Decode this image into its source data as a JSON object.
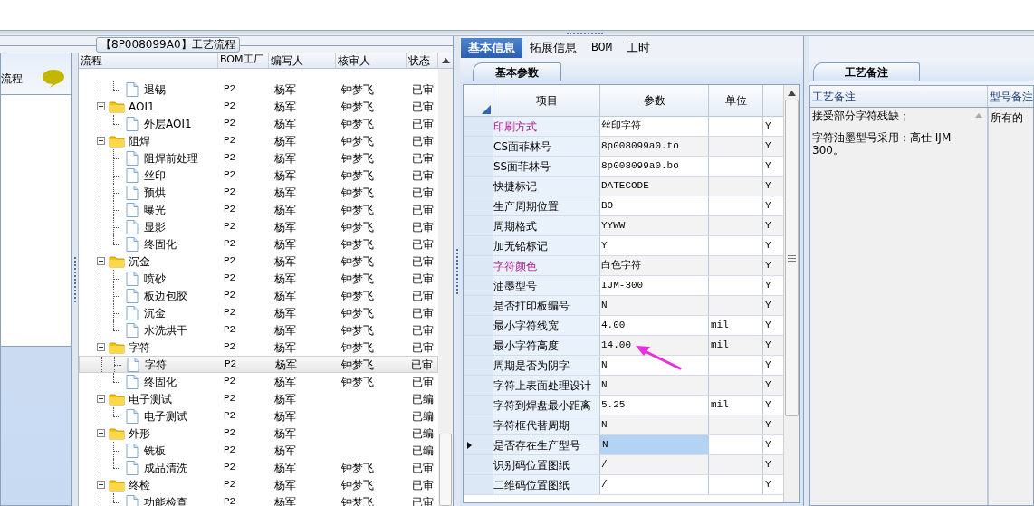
{
  "left_panel": {
    "title": "流程"
  },
  "process_panel": {
    "title": "【8P008099A0】工艺流程",
    "columns": [
      "流程",
      "BOM工厂",
      "编写人",
      "核审人",
      "状态"
    ],
    "continued_children": [
      {
        "name": "退锡",
        "factory": "P2",
        "author": "杨军",
        "reviewer": "钟梦飞",
        "status": "已审",
        "selected": false
      }
    ],
    "groups": [
      {
        "name": "AOI1",
        "factory": "P2",
        "author": "杨军",
        "reviewer": "钟梦飞",
        "status": "已审",
        "expanded": true,
        "selected": false,
        "children": [
          {
            "name": "外层AOI1",
            "factory": "P2",
            "author": "杨军",
            "reviewer": "钟梦飞",
            "status": "已审",
            "selected": false
          }
        ]
      },
      {
        "name": "阻焊",
        "factory": "P2",
        "author": "杨军",
        "reviewer": "钟梦飞",
        "status": "已审",
        "expanded": true,
        "selected": false,
        "children": [
          {
            "name": "阻焊前处理",
            "factory": "P2",
            "author": "杨军",
            "reviewer": "钟梦飞",
            "status": "已审",
            "selected": false
          },
          {
            "name": "丝印",
            "factory": "P2",
            "author": "杨军",
            "reviewer": "钟梦飞",
            "status": "已审",
            "selected": false
          },
          {
            "name": "预烘",
            "factory": "P2",
            "author": "杨军",
            "reviewer": "钟梦飞",
            "status": "已审",
            "selected": false
          },
          {
            "name": "曝光",
            "factory": "P2",
            "author": "杨军",
            "reviewer": "钟梦飞",
            "status": "已审",
            "selected": false
          },
          {
            "name": "显影",
            "factory": "P2",
            "author": "杨军",
            "reviewer": "钟梦飞",
            "status": "已审",
            "selected": false
          },
          {
            "name": "终固化",
            "factory": "P2",
            "author": "杨军",
            "reviewer": "钟梦飞",
            "status": "已审",
            "selected": false
          }
        ]
      },
      {
        "name": "沉金",
        "factory": "P2",
        "author": "杨军",
        "reviewer": "钟梦飞",
        "status": "已审",
        "expanded": true,
        "selected": false,
        "children": [
          {
            "name": "喷砂",
            "factory": "P2",
            "author": "杨军",
            "reviewer": "钟梦飞",
            "status": "已审",
            "selected": false
          },
          {
            "name": "板边包胶",
            "factory": "P2",
            "author": "杨军",
            "reviewer": "钟梦飞",
            "status": "已审",
            "selected": false
          },
          {
            "name": "沉金",
            "factory": "P2",
            "author": "杨军",
            "reviewer": "钟梦飞",
            "status": "已审",
            "selected": false
          },
          {
            "name": "水洗烘干",
            "factory": "P2",
            "author": "杨军",
            "reviewer": "钟梦飞",
            "status": "已审",
            "selected": false
          }
        ]
      },
      {
        "name": "字符",
        "factory": "P2",
        "author": "杨军",
        "reviewer": "钟梦飞",
        "status": "已审",
        "expanded": true,
        "selected": false,
        "children": [
          {
            "name": "字符",
            "factory": "P2",
            "author": "杨军",
            "reviewer": "钟梦飞",
            "status": "已审",
            "selected": true
          },
          {
            "name": "终固化",
            "factory": "P2",
            "author": "杨军",
            "reviewer": "钟梦飞",
            "status": "已审",
            "selected": false
          }
        ]
      },
      {
        "name": "电子测试",
        "factory": "P2",
        "author": "杨军",
        "status": "已编",
        "expanded": true,
        "selected": false,
        "children": [
          {
            "name": "电子测试",
            "factory": "P2",
            "author": "杨军",
            "status": "已编",
            "selected": false
          }
        ]
      },
      {
        "name": "外形",
        "factory": "P2",
        "author": "杨军",
        "status": "已编",
        "expanded": true,
        "selected": false,
        "children": [
          {
            "name": "铣板",
            "factory": "P2",
            "author": "杨军",
            "status": "已编",
            "selected": false
          },
          {
            "name": "成品清洗",
            "factory": "P2",
            "author": "杨军",
            "reviewer": "钟梦飞",
            "status": "已审",
            "selected": false
          }
        ]
      },
      {
        "name": "终检",
        "factory": "P2",
        "author": "杨军",
        "reviewer": "钟梦飞",
        "status": "已审",
        "expanded": true,
        "selected": false,
        "children": [
          {
            "name": "功能检查",
            "factory": "P2",
            "author": "杨军",
            "reviewer": "钟梦飞",
            "status": "已审",
            "selected": false
          }
        ]
      }
    ]
  },
  "detail_panel": {
    "tabs": [
      {
        "label": "基本信息",
        "selected": true
      },
      {
        "label": "拓展信息",
        "selected": false
      },
      {
        "label": "BOM",
        "selected": false
      },
      {
        "label": "工时",
        "selected": false
      }
    ],
    "subtab": "基本参数",
    "columns": [
      "项目",
      "参数",
      "单位"
    ],
    "rows": [
      {
        "item": "印刷方式",
        "value": "丝印字符",
        "flag": "Y",
        "highlight": true,
        "current": false
      },
      {
        "item": "CS面菲林号",
        "value": "8p008099a0.to",
        "flag": "Y",
        "highlight": false,
        "current": false
      },
      {
        "item": "SS面菲林号",
        "value": "8p008099a0.bo",
        "flag": "Y",
        "highlight": false,
        "current": false
      },
      {
        "item": "快捷标记",
        "value": "DATECODE",
        "flag": "Y",
        "highlight": false,
        "current": false
      },
      {
        "item": "生产周期位置",
        "value": "BO",
        "flag": "Y",
        "highlight": false,
        "current": false
      },
      {
        "item": "周期格式",
        "value": "YYWW",
        "flag": "Y",
        "highlight": false,
        "current": false
      },
      {
        "item": "加无铅标记",
        "value": "Y",
        "flag": "Y",
        "highlight": false,
        "current": false
      },
      {
        "item": "字符颜色",
        "value": "白色字符",
        "flag": "Y",
        "highlight": true,
        "current": false
      },
      {
        "item": "油墨型号",
        "value": "IJM-300",
        "flag": "Y",
        "highlight": false,
        "current": false
      },
      {
        "item": "是否打印板编号",
        "value": "N",
        "flag": "Y",
        "highlight": false,
        "current": false
      },
      {
        "item": "最小字符线宽",
        "value": "4.00",
        "unit": "mil",
        "flag": "Y",
        "highlight": false,
        "current": false
      },
      {
        "item": "最小字符高度",
        "value": "14.00",
        "unit": "mil",
        "flag": "Y",
        "highlight": false,
        "current": false
      },
      {
        "item": "周期是否为阴字",
        "value": "N",
        "flag": "Y",
        "highlight": false,
        "current": false
      },
      {
        "item": "字符上表面处理设计",
        "value": "N",
        "flag": "Y",
        "highlight": false,
        "current": false
      },
      {
        "item": "字符到焊盘最小距离",
        "value": "5.25",
        "unit": "mil",
        "flag": "Y",
        "highlight": false,
        "current": false
      },
      {
        "item": "字符框代替周期",
        "value": "N",
        "flag": "Y",
        "highlight": false,
        "current": false
      },
      {
        "item": "是否存在生产型号",
        "value": "N",
        "flag": "Y",
        "highlight": false,
        "current": true
      },
      {
        "item": "识别码位置图纸",
        "value": "/",
        "flag": "Y",
        "highlight": false,
        "current": false
      },
      {
        "item": "二维码位置图纸",
        "value": "/",
        "flag": "Y",
        "highlight": false,
        "current": false
      }
    ]
  },
  "notes_panel": {
    "tab": "工艺备注",
    "columns": [
      "工艺备注",
      "型号备注"
    ],
    "process_notes": [
      "接受部分字符残缺；",
      "字符油墨型号采用：高仕 IJM-300。"
    ],
    "model_note": "所有的"
  }
}
